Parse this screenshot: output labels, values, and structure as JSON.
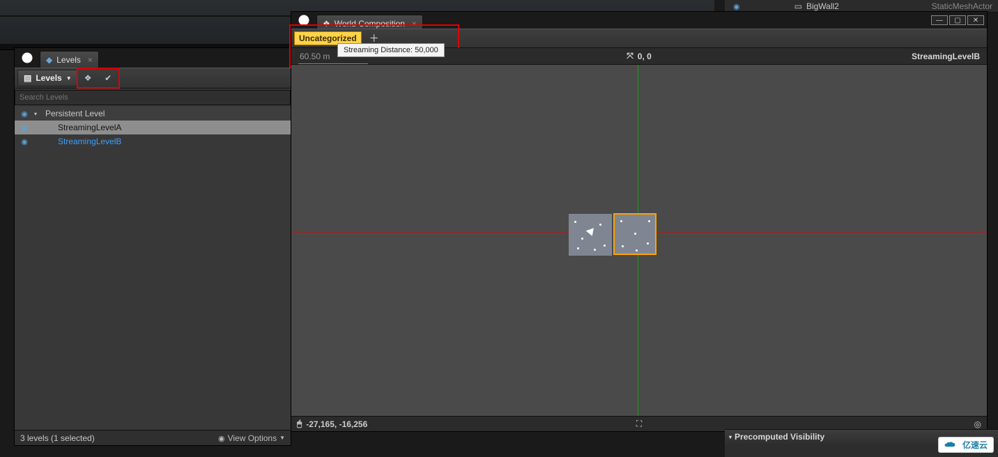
{
  "outliner": {
    "actor": "BigWall2",
    "type": "StaticMeshActor"
  },
  "levels": {
    "tab_label": "Levels",
    "dropdown_label": "Levels",
    "search_placeholder": "Search Levels",
    "items": [
      {
        "name": "Persistent Level",
        "kind": "persistent"
      },
      {
        "name": "StreamingLevelA",
        "kind": "a"
      },
      {
        "name": "StreamingLevelB",
        "kind": "b"
      }
    ],
    "footer_status": "3 levels (1 selected)",
    "view_options": "View Options"
  },
  "worldcomp": {
    "tab_label": "World Composition",
    "layer": "Uncategorized",
    "tooltip": "Streaming Distance: 50,000",
    "scale": "60.50 m",
    "origin": "0, 0",
    "current_level": "StreamingLevelB",
    "mouse_coords": "-27,165, -16,256"
  },
  "details": {
    "section": "Precomputed Visibility"
  },
  "watermark": "亿速云"
}
